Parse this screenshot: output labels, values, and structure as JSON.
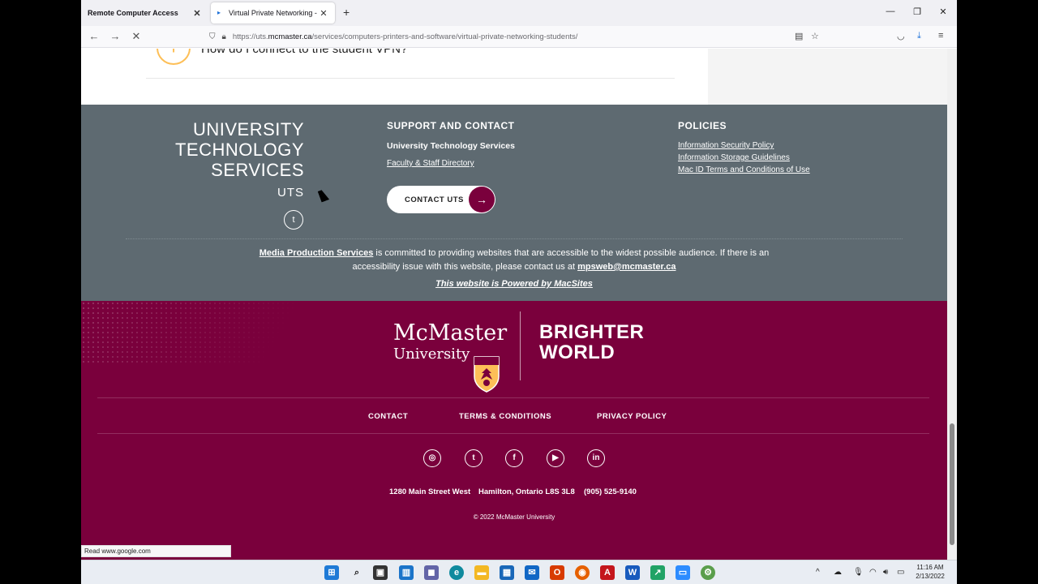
{
  "browser": {
    "tabs": [
      {
        "title": "Remote Computer Access",
        "active": false
      },
      {
        "title": "Virtual Private Networking - for",
        "active": true
      }
    ],
    "url_prefix": "https://uts.",
    "url_host": "mcmaster.ca",
    "url_path": "/services/computers-printers-and-software/virtual-private-networking-students/",
    "status_text": "Read www.google.com"
  },
  "faq": {
    "item": "How do I connect to the student VPN?"
  },
  "uts_footer": {
    "name_lines": [
      "UNIVERSITY",
      "TECHNOLOGY",
      "SERVICES"
    ],
    "abbr": "UTS",
    "support_heading": "SUPPORT AND CONTACT",
    "support_org": "University Technology Services",
    "directory_link": "Faculty & Staff Directory",
    "contact_button": "CONTACT UTS",
    "policies_heading": "POLICIES",
    "policies": [
      "Information Security Policy",
      "Information Storage Guidelines",
      "Mac ID Terms and Conditions of Use"
    ],
    "accessibility_link": "Media Production Services",
    "accessibility_text": " is committed to providing websites that are accessible to the widest possible audience. If there is an accessibility issue with this website, please contact us at ",
    "accessibility_email": "mpsweb@mcmaster.ca",
    "powered_by": "This website is Powered by MacSites"
  },
  "mcmaster_footer": {
    "logo_line1": "McMaster",
    "logo_line2": "University",
    "tagline_line1": "BRIGHTER",
    "tagline_line2": "WORLD",
    "nav": [
      "CONTACT",
      "TERMS & CONDITIONS",
      "PRIVACY POLICY"
    ],
    "social": [
      "instagram",
      "twitter",
      "facebook",
      "youtube",
      "linkedin"
    ],
    "address": [
      "1280 Main Street West",
      "Hamilton, Ontario  L8S 3L8",
      "(905) 525-9140"
    ],
    "copyright": "© 2022 McMaster University"
  },
  "taskbar": {
    "time": "11:16 AM",
    "date": "2/13/2022"
  }
}
